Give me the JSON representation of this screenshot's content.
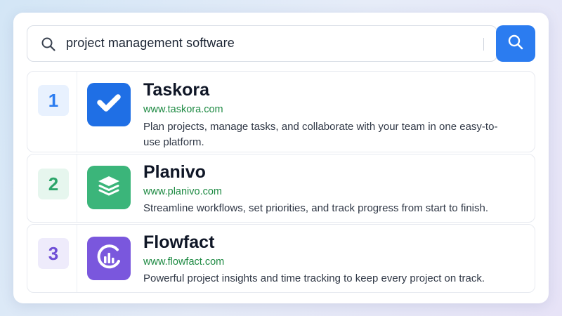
{
  "search": {
    "query": "project management software",
    "icon": "search-icon",
    "button_icon": "search-icon"
  },
  "results": [
    {
      "rank": "1",
      "title": "Taskora",
      "url": "www.taskora.com",
      "description": "Plan projects, manage tasks, and collaborate with your team in one easy-to-use platform.",
      "logo_icon": "checkmark-icon",
      "logo_color": "#1f6fe5",
      "rank_color": "#2b7cf0",
      "rank_bg": "#e8f1fe"
    },
    {
      "rank": "2",
      "title": "Planivo",
      "url": "www.planivo.com",
      "description": "Streamline workflows, set priorities, and track progress from start to finish.",
      "logo_icon": "layers-icon",
      "logo_color": "#3bb57a",
      "rank_color": "#2ca56a",
      "rank_bg": "#e6f6ee"
    },
    {
      "rank": "3",
      "title": "Flowfact",
      "url": "www.flowfact.com",
      "description": "Powerful project insights and time tracking to keep every project on track.",
      "logo_icon": "analytics-chart-icon",
      "logo_color": "#7a57dd",
      "rank_color": "#6f4fd6",
      "rank_bg": "#eeebfb"
    }
  ],
  "colors": {
    "accent": "#2b7cf0",
    "url_green": "#1e8a43"
  }
}
